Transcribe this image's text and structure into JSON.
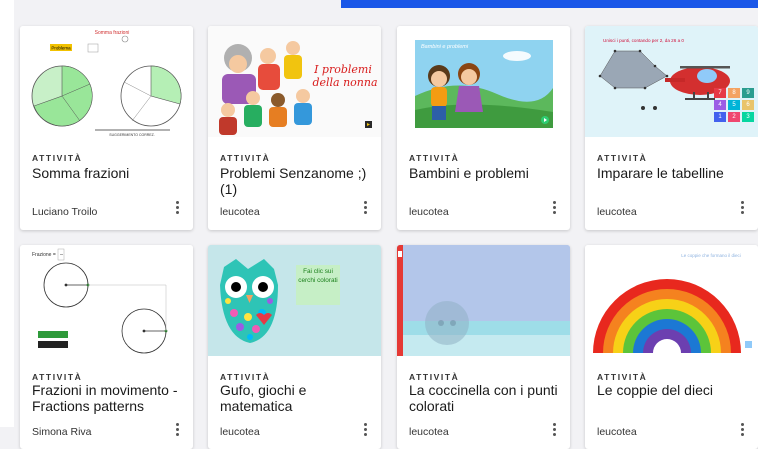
{
  "cards": [
    {
      "kind": "ATTIVITÀ",
      "title": "Somma frazioni",
      "author": "Luciano Troilo"
    },
    {
      "kind": "ATTIVITÀ",
      "title": "Problemi Senzanome ;) (1)",
      "author": "leucotea"
    },
    {
      "kind": "ATTIVITÀ",
      "title": "Bambini e problemi",
      "author": "leucotea"
    },
    {
      "kind": "ATTIVITÀ",
      "title": "Imparare le tabelline",
      "author": "leucotea"
    },
    {
      "kind": "ATTIVITÀ",
      "title": "Frazioni in movimento - Fractions patterns",
      "author": "Simona Riva"
    },
    {
      "kind": "ATTIVITÀ",
      "title": "Gufo, giochi e matematica",
      "author": "leucotea"
    },
    {
      "kind": "ATTIVITÀ",
      "title": "La coccinella con i punti colorati",
      "author": "leucotea"
    },
    {
      "kind": "ATTIVITÀ",
      "title": "Le coppie del dieci",
      "author": "leucotea"
    }
  ],
  "thumbs": {
    "t1": {
      "heading": "Somma frazioni",
      "label": "Problema",
      "caption": "SUGGERIMENTO CORREZ."
    },
    "t2": {
      "line1": "I problemi",
      "line2": "della nonna"
    },
    "t3": {
      "heading": "Bambini e problemi"
    },
    "t4": {
      "heading": "Unisci i punti, contando per 2, da 26 a 0",
      "keys": [
        "7",
        "8",
        "9",
        "4",
        "5",
        "6",
        "1",
        "2",
        "3"
      ]
    },
    "t5": {
      "label": "Frazione ="
    },
    "t6": {
      "bubble": "Fai clic sui cerchi colorati"
    },
    "t8": {
      "heading": "Le coppie che formano il dieci"
    }
  },
  "colors": {
    "accent": "#1a57e8",
    "rainbow": [
      "#e8281e",
      "#f5821f",
      "#f7d117",
      "#5cc43a",
      "#1c78d4",
      "#6c3fb0"
    ]
  }
}
